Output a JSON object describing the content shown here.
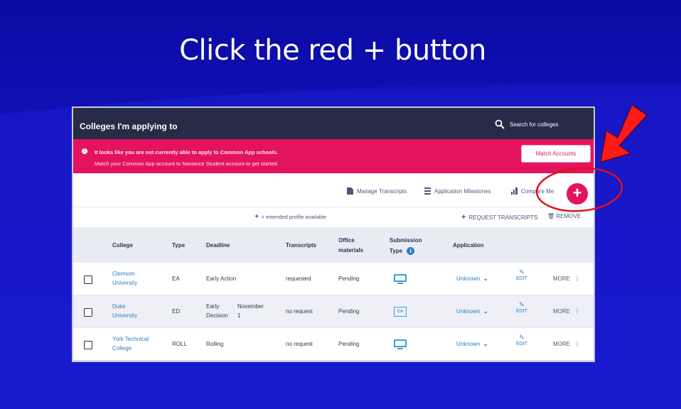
{
  "slide": {
    "title": "Click the red + button"
  },
  "topbar": {
    "title": "Colleges I'm applying to",
    "search_label": "Search for colleges"
  },
  "alert": {
    "line1": "It looks like you are not currently able to apply to Common App schools.",
    "line2": "Match your Common App account to Naviance Student account to get started.",
    "button": "Match Accounts"
  },
  "toolbar": {
    "manage_transcripts": "Manage Transcripts",
    "application_milestones": "Application Milestones",
    "compare_me": "Compare Me",
    "add_symbol": "+"
  },
  "subbar": {
    "extended_note": "= extended profile available",
    "request_transcripts": "REQUEST TRANSCRIPTS",
    "remove": "REMOVE"
  },
  "table": {
    "headers": {
      "college": "College",
      "type": "Type",
      "deadline": "Deadline",
      "transcripts": "Transcripts",
      "office_line1": "Office",
      "office_line2": "materials",
      "submission_line1": "Submission",
      "submission_line2": "Type",
      "application": "Application"
    },
    "rows": [
      {
        "college_line1": "Clemson",
        "college_line2": "University",
        "type": "EA",
        "deadline_line1": "Early Action",
        "deadline_line2": "",
        "deadline_date_line1": "",
        "deadline_date_line2": "",
        "transcripts": "requested",
        "office": "Pending",
        "submission_icon": "monitor-icon",
        "application": "Unknown",
        "edit": "EDIT",
        "more": "MORE"
      },
      {
        "college_line1": "Duke",
        "college_line2": "University",
        "type": "ED",
        "deadline_line1": "Early",
        "deadline_line2": "Decision",
        "deadline_date_line1": "November",
        "deadline_date_line2": "1",
        "transcripts": "no request",
        "office": "Pending",
        "submission_icon": "common-app-icon",
        "submission_text": "CA",
        "application": "Unknown",
        "edit": "EDIT",
        "more": "MORE"
      },
      {
        "college_line1": "York Technical",
        "college_line2": "College",
        "type": "ROLL",
        "deadline_line1": "Rolling",
        "deadline_line2": "",
        "deadline_date_line1": "",
        "deadline_date_line2": "",
        "transcripts": "no request",
        "office": "Pending",
        "submission_icon": "monitor-icon",
        "application": "Unknown",
        "edit": "EDIT",
        "more": "MORE"
      }
    ]
  },
  "annotations": {
    "arrow_color": "#ff1a1a",
    "circle_color": "#e01020"
  },
  "colors": {
    "slide_bg": "#1414c0",
    "topbar": "#262b46",
    "alert": "#e3135f",
    "add_button": "#e3135f",
    "link": "#2f7fc1"
  }
}
